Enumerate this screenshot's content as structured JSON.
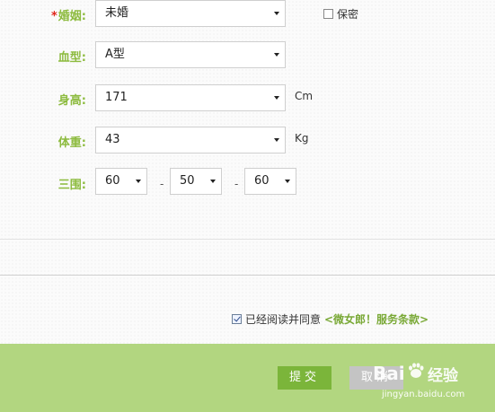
{
  "form": {
    "marriage": {
      "label": "婚姻:",
      "required_mark": "*",
      "value": "未婚",
      "privacy_label": "保密",
      "privacy_checked": false
    },
    "blood_type": {
      "label": "血型:",
      "value": "A型"
    },
    "height": {
      "label": "身高:",
      "value": "171",
      "unit": "Cm"
    },
    "weight": {
      "label": "体重:",
      "value": "43",
      "unit": "Kg"
    },
    "measurements": {
      "label": "三围:",
      "bust": "60",
      "waist": "50",
      "hips": "60",
      "separator": "-"
    }
  },
  "agreement": {
    "checked": true,
    "text": "已经阅读并同意",
    "link": "<微女郎！服务条款>"
  },
  "footer": {
    "submit_label": "提交",
    "cancel_label": "取消",
    "bg_color": "#b2d680",
    "submit_color": "#7bb53a",
    "cancel_color": "#c4c4c4"
  },
  "watermark": {
    "brand": "Bai",
    "brand_suffix": "经验",
    "url": "jingyan.baidu.com"
  }
}
